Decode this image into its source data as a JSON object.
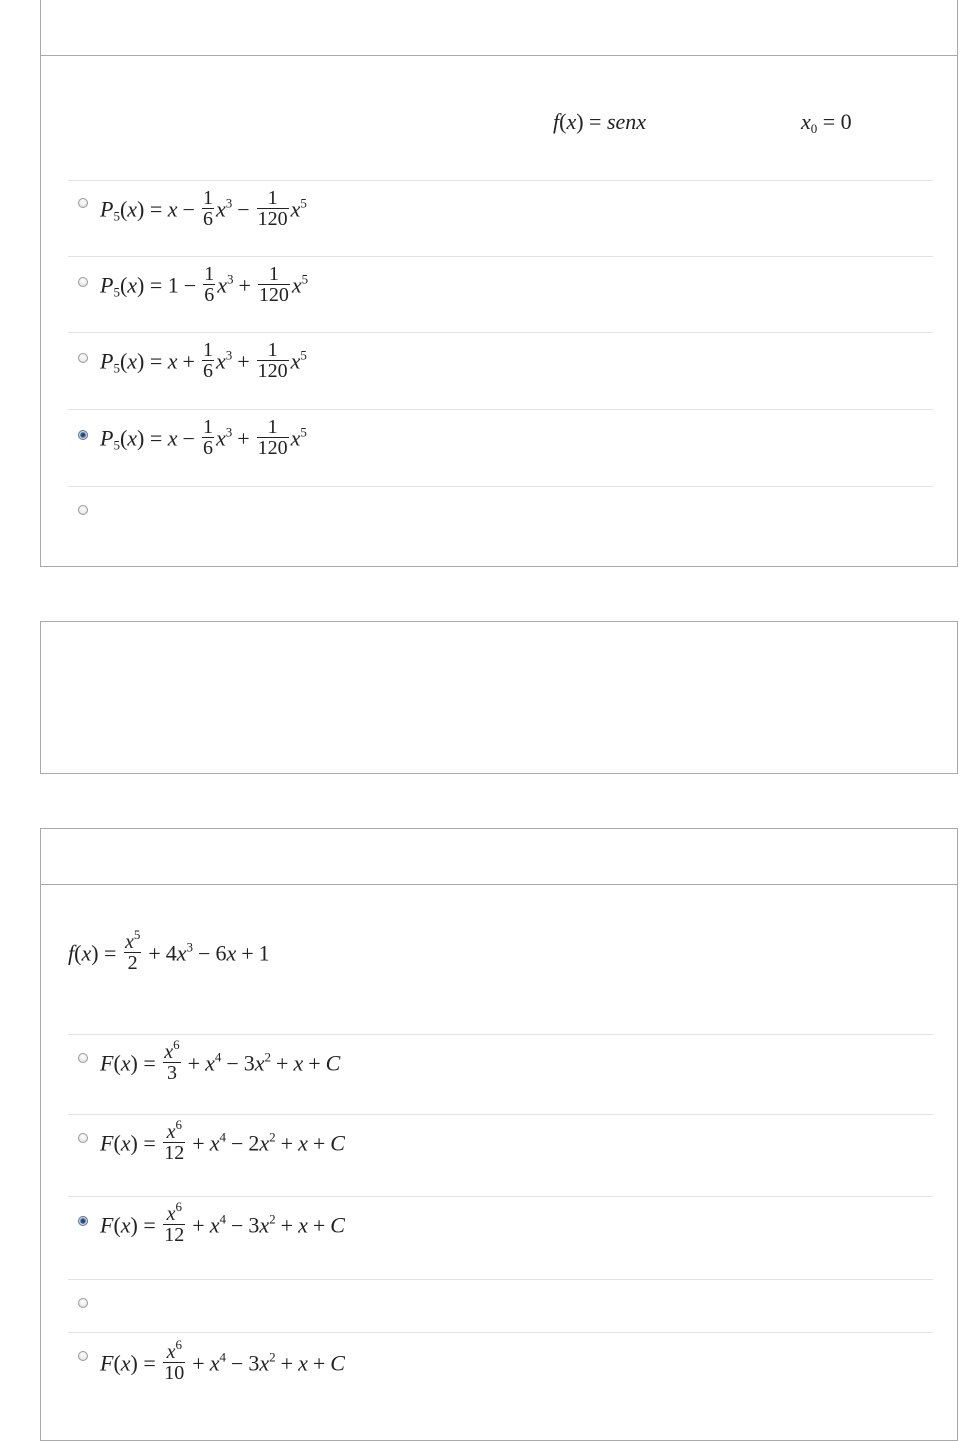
{
  "question1": {
    "function_text": "f(x) = senx",
    "point_text": "x0 = 0",
    "options": [
      {
        "formula": "P5(x) = x − (1/6)x³ − (1/120)x⁵",
        "selected": false
      },
      {
        "formula": "P5(x) = 1 − (1/6)x³ + (1/120)x⁵",
        "selected": false
      },
      {
        "formula": "P5(x) = x + (1/6)x³ + (1/120)x⁵",
        "selected": false
      },
      {
        "formula": "P5(x) = x − (1/6)x³ + (1/120)x⁵",
        "selected": true
      },
      {
        "formula": "",
        "selected": false
      }
    ]
  },
  "question3": {
    "function_text": "f(x) = x⁵/2 + 4x³ − 6x + 1",
    "options": [
      {
        "formula": "F(x) = x⁶/3 + x⁴ − 3x² + x + C",
        "selected": false
      },
      {
        "formula": "F(x) = x⁶/12 + x⁴ − 2x² + x + C",
        "selected": false
      },
      {
        "formula": "F(x) = x⁶/12 + x⁴ − 3x² + x + C",
        "selected": true
      },
      {
        "formula": "",
        "selected": false
      },
      {
        "formula": "F(x) = x⁶/10 + x⁴ − 3x² + x + C",
        "selected": false
      }
    ]
  }
}
